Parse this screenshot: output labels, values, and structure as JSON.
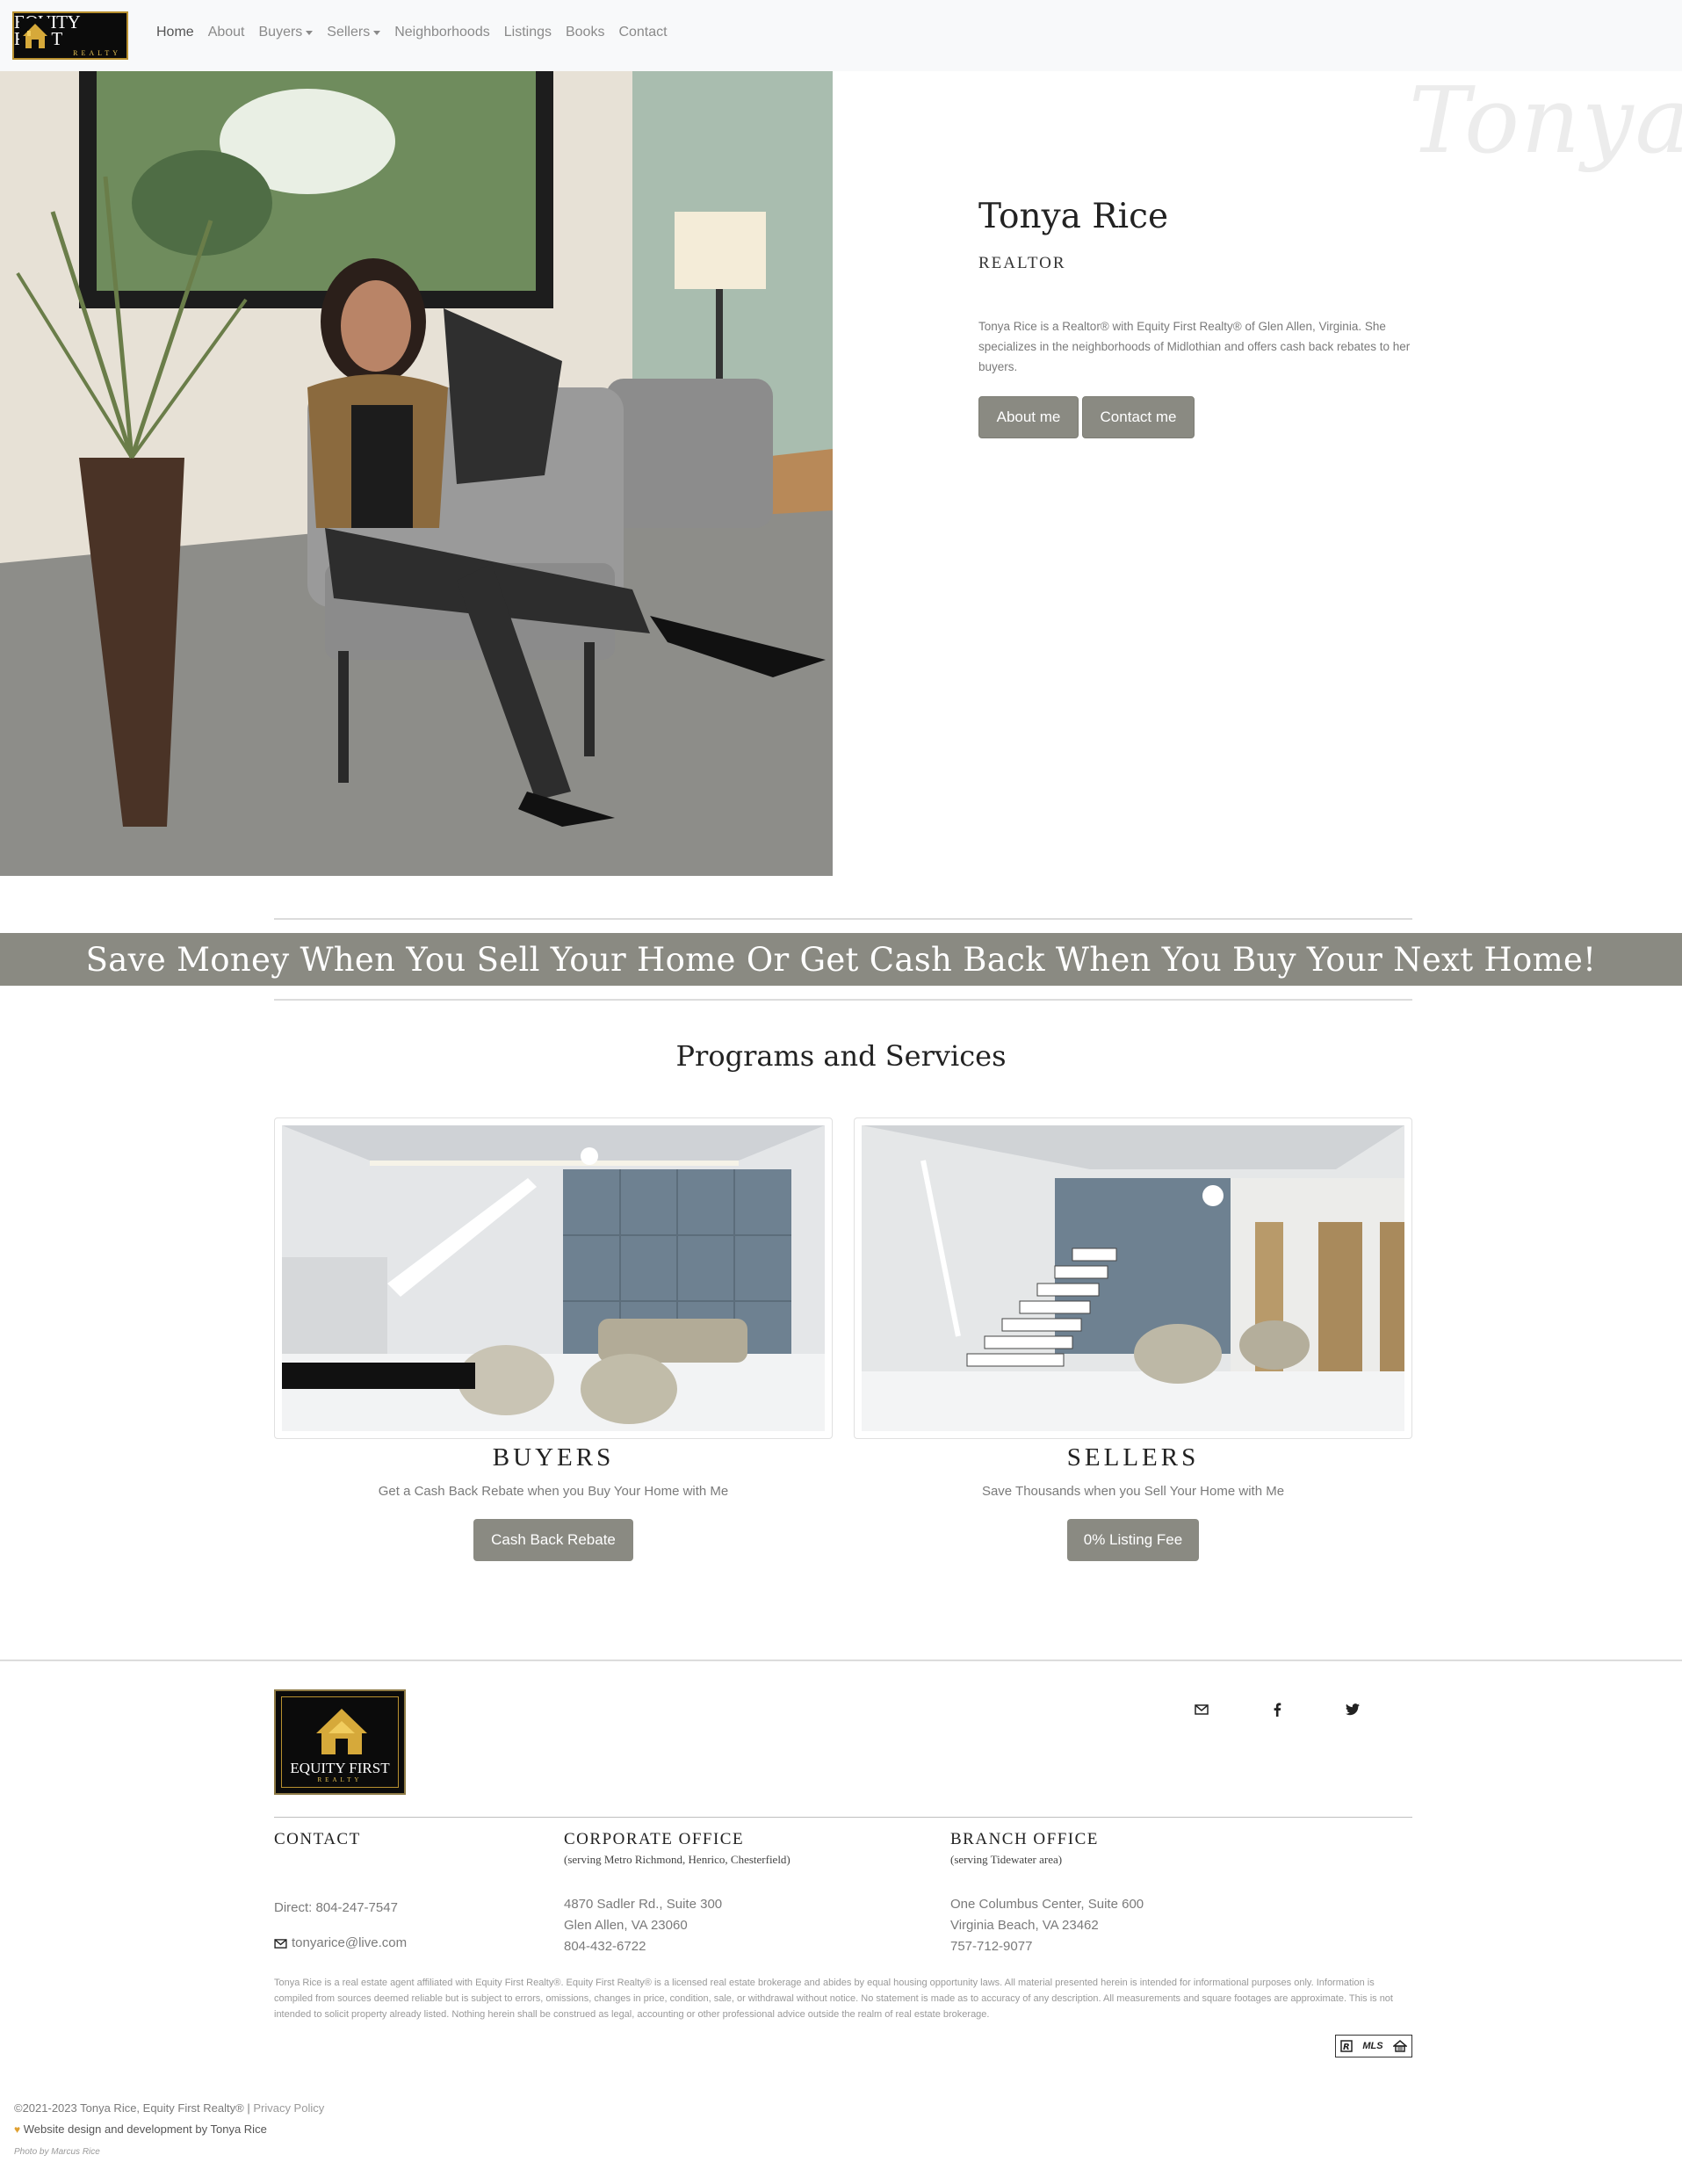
{
  "brand": {
    "logo_line1": "EQUITY FIRST",
    "logo_line2": "REALTY"
  },
  "nav": {
    "items": [
      {
        "label": "Home",
        "active": true,
        "dropdown": false
      },
      {
        "label": "About",
        "active": false,
        "dropdown": false
      },
      {
        "label": "Buyers",
        "active": false,
        "dropdown": true
      },
      {
        "label": "Sellers",
        "active": false,
        "dropdown": true
      },
      {
        "label": "Neighborhoods",
        "active": false,
        "dropdown": false
      },
      {
        "label": "Listings",
        "active": false,
        "dropdown": false
      },
      {
        "label": "Books",
        "active": false,
        "dropdown": false
      },
      {
        "label": "Contact",
        "active": false,
        "dropdown": false
      }
    ]
  },
  "hero": {
    "script_name": "Tonya",
    "name": "Tonya Rice",
    "role": "REALTOR",
    "bio": "Tonya Rice is a Realtor® with Equity First Realty® of Glen Allen, Virginia. She specializes in the neighborhoods of Midlothian and offers cash back rebates to her buyers.",
    "about_button": "About me",
    "contact_button": "Contact me"
  },
  "banner": {
    "text": "Save Money When You Sell Your Home Or Get Cash Back When You Buy Your Next Home!"
  },
  "programs": {
    "title": "Programs and Services",
    "cards": [
      {
        "title": "BUYERS",
        "subtitle": "Get a Cash Back Rebate when you Buy Your Home with Me",
        "button": "Cash Back Rebate"
      },
      {
        "title": "SELLERS",
        "subtitle": "Save Thousands when you Sell Your Home with Me",
        "button": "0% Listing Fee"
      }
    ]
  },
  "footer": {
    "logo_line1": "EQUITY FIRST",
    "logo_line2": "REALTY",
    "social_icons": [
      "envelope-icon",
      "facebook-icon",
      "twitter-icon"
    ],
    "contact": {
      "heading": "CONTACT",
      "direct": "Direct: 804-247-7547",
      "email": "tonyarice@live.com"
    },
    "corporate": {
      "heading": "CORPORATE OFFICE",
      "sub": "(serving Metro Richmond, Henrico, Chesterfield)",
      "line1": "4870 Sadler Rd., Suite 300",
      "line2": "Glen Allen, VA 23060",
      "phone": "804-432-6722"
    },
    "branch": {
      "heading": "BRANCH OFFICE",
      "sub": "(serving Tidewater area)",
      "line1": "One Columbus Center, Suite 600",
      "line2": "Virginia Beach, VA 23462",
      "phone": "757-712-9077"
    },
    "disclaimer": "Tonya Rice is a real estate agent affiliated with Equity First Realty®. Equity First Realty® is a licensed real estate brokerage and abides by equal housing opportunity laws. All material presented herein is intended for informational purposes only. Information is compiled from sources deemed reliable but is subject to errors, omissions, changes in price, condition, sale, or withdrawal without notice. No statement is made as to accuracy of any description. All measurements and square footages are approximate. This is not intended to solicit property already listed. Nothing herein shall be construed as legal, accounting or other professional advice outside the realm of real estate brokerage.",
    "mls_label": "MLS",
    "copyright": "©2021-2023 Tonya Rice, Equity First Realty® |",
    "privacy": "Privacy Policy",
    "credit_prefix": "Website design and development by",
    "credit_author": "Tonya Rice",
    "photo_credit": "Photo by Marcus Rice"
  },
  "colors": {
    "accent_gray": "#8a8a82",
    "nav_bg": "#f8f9fa",
    "logo_gold": "#e8c352"
  }
}
